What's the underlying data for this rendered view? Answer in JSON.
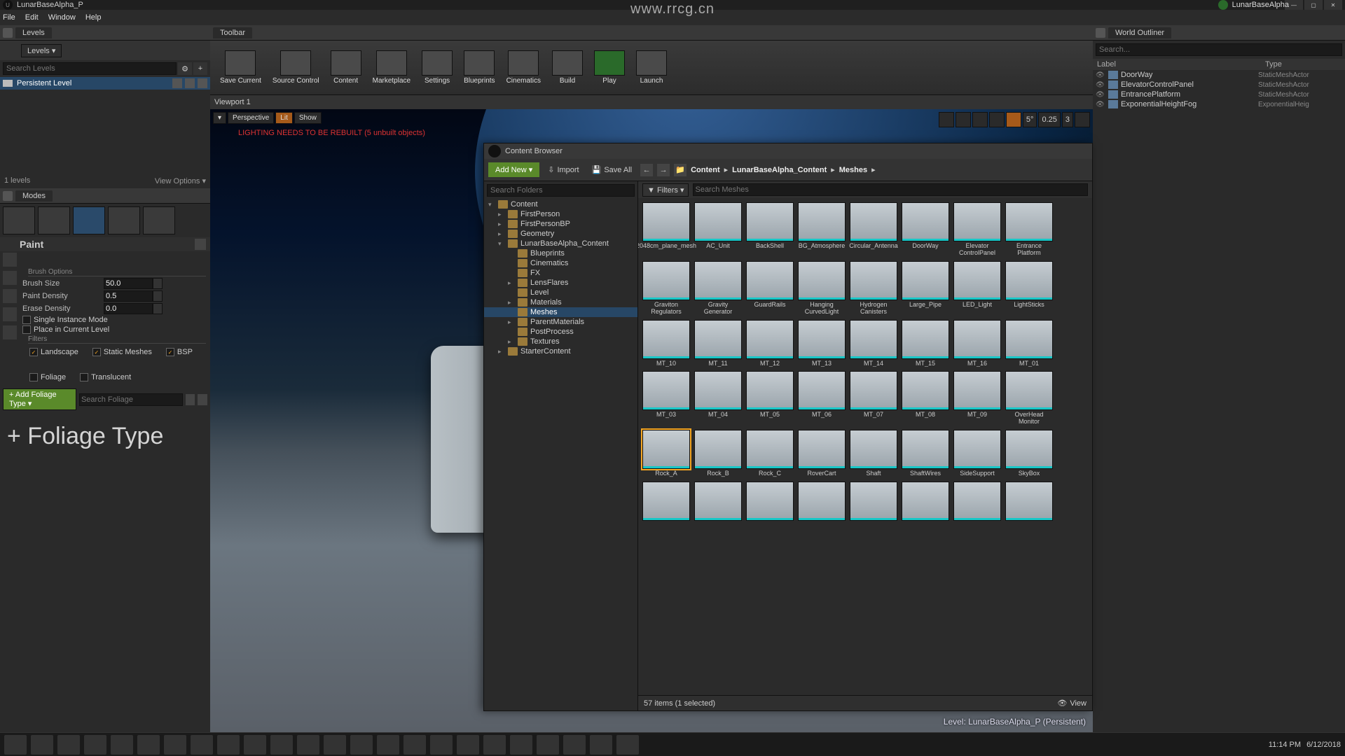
{
  "window": {
    "title": "LunarBaseAlpha_P",
    "project": "LunarBaseAlpha"
  },
  "watermark": "www.rrcg.cn",
  "menu": {
    "file": "File",
    "edit": "Edit",
    "window": "Window",
    "help": "Help"
  },
  "levels_panel": {
    "tab": "Levels",
    "dropdown": "Levels ▾",
    "search_ph": "Search Levels",
    "item": "Persistent Level",
    "count": "1 levels",
    "viewopts": "View Options ▾"
  },
  "modes_panel": {
    "tab": "Modes"
  },
  "paint": {
    "title": "Paint",
    "brush_options": "Brush Options",
    "brush_size_l": "Brush Size",
    "brush_size_v": "50.0",
    "paint_density_l": "Paint Density",
    "paint_density_v": "0.5",
    "erase_density_l": "Erase Density",
    "erase_density_v": "0.0",
    "single_instance": "Single Instance Mode",
    "place_current": "Place in Current Level",
    "filters": "Filters",
    "landscape": "Landscape",
    "static_meshes": "Static Meshes",
    "bsp": "BSP",
    "foliage": "Foliage",
    "translucent": "Translucent",
    "add_type": "+ Add Foliage Type ▾",
    "search_foliage_ph": "Search Foliage",
    "big": "+ Foliage Type"
  },
  "toolbar": {
    "tab": "Toolbar",
    "save": "Save Current",
    "src": "Source Control",
    "content": "Content",
    "market": "Marketplace",
    "settings": "Settings",
    "blueprints": "Blueprints",
    "cinem": "Cinematics",
    "build": "Build",
    "play": "Play",
    "launch": "Launch"
  },
  "viewport": {
    "tab": "Viewport 1",
    "persp": "Perspective",
    "lit": "Lit",
    "show": "Show",
    "warning": "LIGHTING NEEDS TO BE REBUILT (5 unbuilt objects)",
    "angle": "5°",
    "scale": "0.25",
    "grid": "3",
    "level_label": "Level: LunarBaseAlpha_P (Persistent)"
  },
  "content_browser": {
    "tab": "Content Browser",
    "addnew": "Add New ▾",
    "import": "Import",
    "saveall": "Save All",
    "crumb1": "Content",
    "crumb2": "LunarBaseAlpha_Content",
    "crumb3": "Meshes",
    "searchfolders_ph": "Search Folders",
    "filters": "Filters ▾",
    "searchmesh_ph": "Search Meshes",
    "tree": [
      {
        "name": "Content",
        "depth": 0,
        "exp": "▾"
      },
      {
        "name": "FirstPerson",
        "depth": 1,
        "exp": "▸"
      },
      {
        "name": "FirstPersonBP",
        "depth": 1,
        "exp": "▸"
      },
      {
        "name": "Geometry",
        "depth": 1,
        "exp": "▸"
      },
      {
        "name": "LunarBaseAlpha_Content",
        "depth": 1,
        "exp": "▾"
      },
      {
        "name": "Blueprints",
        "depth": 2,
        "exp": ""
      },
      {
        "name": "Cinematics",
        "depth": 2,
        "exp": ""
      },
      {
        "name": "FX",
        "depth": 2,
        "exp": ""
      },
      {
        "name": "LensFlares",
        "depth": 2,
        "exp": "▸"
      },
      {
        "name": "Level",
        "depth": 2,
        "exp": ""
      },
      {
        "name": "Materials",
        "depth": 2,
        "exp": "▸"
      },
      {
        "name": "Meshes",
        "depth": 2,
        "exp": "",
        "sel": true
      },
      {
        "name": "ParentMaterials",
        "depth": 2,
        "exp": "▸"
      },
      {
        "name": "PostProcess",
        "depth": 2,
        "exp": ""
      },
      {
        "name": "Textures",
        "depth": 2,
        "exp": "▸"
      },
      {
        "name": "StarterContent",
        "depth": 1,
        "exp": "▸"
      }
    ],
    "assets": [
      "2048cm_plane_mesh",
      "AC_Unit",
      "BackShell",
      "BG_Atmosphere",
      "Circular_Antenna",
      "DoorWay",
      "Elevator ControlPanel",
      "Entrance Platform",
      "Graviton Regulators",
      "Gravity Generator",
      "GuardRails",
      "Hanging CurvedLight",
      "Hydrogen Canisters",
      "Large_Pipe",
      "LED_Light",
      "LightSticks",
      "MT_10",
      "MT_11",
      "MT_12",
      "MT_13",
      "MT_14",
      "MT_15",
      "MT_16",
      "MT_01",
      "MT_03",
      "MT_04",
      "MT_05",
      "MT_06",
      "MT_07",
      "MT_08",
      "MT_09",
      "OverHead Monitor",
      "Rock_A",
      "Rock_B",
      "Rock_C",
      "RoverCart",
      "Shaft",
      "ShaftWires",
      "SideSupport",
      "SkyBox",
      " ",
      " ",
      " ",
      " ",
      " ",
      " ",
      " ",
      " "
    ],
    "selected_asset": "Rock_A",
    "status": "57 items (1 selected)",
    "view": "View"
  },
  "world_outliner": {
    "tab": "World Outliner",
    "search_ph": "Search...",
    "col1": "Label",
    "col2": "Type",
    "rows": [
      {
        "label": "DoorWay",
        "type": "StaticMeshActor"
      },
      {
        "label": "ElevatorControlPanel",
        "type": "StaticMeshActor"
      },
      {
        "label": "EntrancePlatform",
        "type": "StaticMeshActor"
      },
      {
        "label": "ExponentialHeightFog",
        "type": "ExponentialHeig"
      }
    ]
  },
  "tray": {
    "time": "11:14 PM",
    "date": "6/12/2018"
  }
}
